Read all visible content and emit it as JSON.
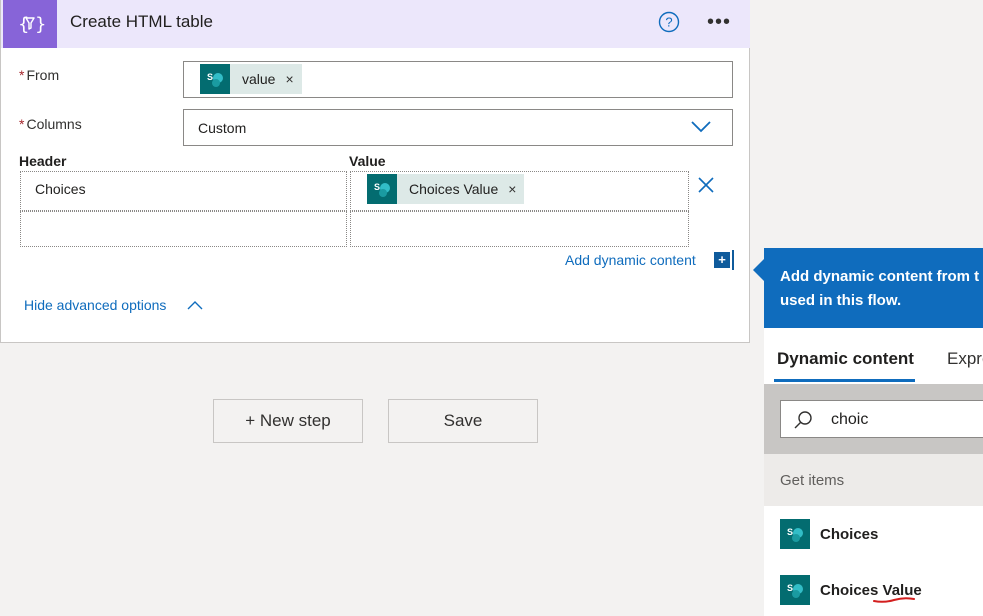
{
  "action": {
    "title": "Create HTML table",
    "icon": "data-operation-icon",
    "help_icon": "help-icon",
    "more_label": "•••"
  },
  "fields": {
    "from": {
      "required_mark": "*",
      "label": "From",
      "token_label": "value",
      "token_close": "×"
    },
    "columns": {
      "required_mark": "*",
      "label": "Columns",
      "value": "Custom"
    }
  },
  "table": {
    "header_label": "Header",
    "value_label": "Value",
    "rows": [
      {
        "header": "Choices",
        "value_token": "Choices Value",
        "token_close": "×"
      },
      {
        "header": "",
        "value_token": ""
      }
    ]
  },
  "add_dynamic_content": {
    "label": "Add dynamic content",
    "plus": "+"
  },
  "hide_advanced": {
    "label": "Hide advanced options"
  },
  "buttons": {
    "new_step": "+ New step",
    "save": "Save"
  },
  "panel": {
    "header_text_line1": "Add dynamic content from t",
    "header_text_line2": "used in this flow.",
    "tabs": [
      {
        "label": "Dynamic content",
        "active": true
      },
      {
        "label": "Expre",
        "active": false
      }
    ],
    "search": {
      "value": "choic"
    },
    "group": "Get items",
    "items": [
      {
        "label": "Choices"
      },
      {
        "label_prefix": "Choices ",
        "label_underlined": "Value"
      }
    ]
  },
  "colors": {
    "action_accent": "#8764d8",
    "header_bg": "#ece7fb",
    "link": "#0f6cbd",
    "sharepoint": "#036c70",
    "panel_header": "#0f6cbd"
  }
}
